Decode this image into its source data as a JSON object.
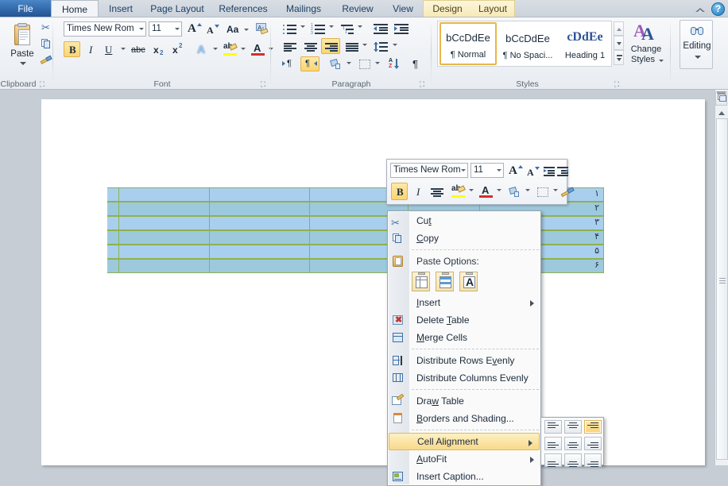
{
  "app": {
    "name": "Microsoft Word 2010"
  },
  "ribbon": {
    "tabs": [
      {
        "id": "file",
        "label": "File"
      },
      {
        "id": "home",
        "label": "Home"
      },
      {
        "id": "insert",
        "label": "Insert"
      },
      {
        "id": "page-layout",
        "label": "Page Layout"
      },
      {
        "id": "references",
        "label": "References"
      },
      {
        "id": "mailings",
        "label": "Mailings"
      },
      {
        "id": "review",
        "label": "Review"
      },
      {
        "id": "view",
        "label": "View"
      },
      {
        "id": "design",
        "label": "Design"
      },
      {
        "id": "layout",
        "label": "Layout"
      }
    ],
    "active_tab": "Home",
    "contextual_tabs": [
      "Design",
      "Layout"
    ],
    "help_icon": "help-question-icon",
    "collapse_icon": "collapse-ribbon-icon",
    "groups": {
      "clipboard": {
        "label": "Clipboard",
        "paste_label": "Paste",
        "paste_icon": "paste-clipboard-icon",
        "cut_icon": "cut-scissors-icon",
        "copy_icon": "copy-icon",
        "format_painter_icon": "format-painter-icon",
        "dialog_launcher": "dialog-launcher-icon"
      },
      "font": {
        "label": "Font",
        "font_name": "Times New Rom",
        "font_size": "11",
        "grow_font_icon": "grow-font-icon",
        "shrink_font_icon": "shrink-font-icon",
        "change_case_label": "Aa",
        "clear_formatting_icon": "clear-formatting-icon",
        "bold_label": "B",
        "italic_label": "I",
        "underline_label": "U",
        "strikethrough_label": "abc",
        "subscript_label": "x",
        "superscript_label": "x",
        "text_effects_label": "A",
        "highlight_label": "ab",
        "font_color_label": "A",
        "bold_active": true,
        "dialog_launcher": "dialog-launcher-icon"
      },
      "paragraph": {
        "label": "Paragraph",
        "bullets_icon": "bullets-icon",
        "numbering_icon": "numbering-icon",
        "multilevel_icon": "multilevel-list-icon",
        "decrease_indent_icon": "decrease-indent-icon",
        "increase_indent_icon": "increase-indent-icon",
        "align_left_icon": "align-left-icon",
        "align_center_icon": "align-center-icon",
        "align_right_icon": "align-right-icon",
        "justify_icon": "justify-icon",
        "line_spacing_icon": "line-spacing-icon",
        "ltr_icon": "left-to-right-icon",
        "rtl_icon": "right-to-left-icon",
        "shading_icon": "shading-icon",
        "borders_icon": "borders-icon",
        "sort_icon": "sort-icon",
        "show_marks_icon": "show-formatting-marks-icon",
        "align_right_active": true,
        "rtl_active": true,
        "dialog_launcher": "dialog-launcher-icon"
      },
      "styles": {
        "label": "Styles",
        "gallery": [
          {
            "preview": "bCcDdEe",
            "name": "¶ Normal",
            "selected": true
          },
          {
            "preview": "bCcDdEe",
            "name": "¶ No Spaci...",
            "selected": false
          },
          {
            "preview": "cDdEe",
            "name": "Heading 1",
            "selected": false
          }
        ],
        "scroll_up_icon": "scroll-up-icon",
        "scroll_down_icon": "scroll-down-icon",
        "more_icon": "more-styles-icon",
        "change_styles_label": "Change\nStyles",
        "change_styles_line1": "Change",
        "change_styles_line2": "Styles",
        "change_styles_icon": "change-styles-icon",
        "dialog_launcher": "dialog-launcher-icon"
      },
      "editing": {
        "label": "Editing",
        "editing_label": "Editing",
        "editing_icon": "find-binoculars-icon"
      }
    }
  },
  "document": {
    "table": {
      "rows": 6,
      "columns": 5,
      "row_numbers": [
        "۱",
        "۲",
        "۳",
        "۴",
        "۵",
        "۶"
      ],
      "selected": true,
      "selection_color_a": "#a9cfee",
      "selection_color_b": "#9dc9dd",
      "gridline_color": "#8fb14d"
    }
  },
  "mini_toolbar": {
    "font_name": "Times New Rom",
    "font_size": "11",
    "grow_font_icon": "grow-font-icon",
    "shrink_font_icon": "shrink-font-icon",
    "decrease_indent_icon": "decrease-indent-icon",
    "increase_indent_icon": "increase-indent-icon",
    "bold_label": "B",
    "italic_label": "I",
    "align_icon": "align-center-icon",
    "highlight_label": "ab",
    "font_color_label": "A",
    "shading_icon": "shading-icon",
    "borders_icon": "borders-icon",
    "format_painter_icon": "format-painter-icon",
    "bold_active": true
  },
  "context_menu": {
    "items": [
      {
        "label": "Cut",
        "icon": "cut-scissors-icon",
        "type": "item",
        "accel": 2
      },
      {
        "label": "Copy",
        "icon": "copy-icon",
        "type": "item",
        "accel": 0
      },
      {
        "label": "Paste Options:",
        "icon": "paste-clipboard-icon",
        "type": "header",
        "accel": -1
      },
      {
        "label": "Insert",
        "icon": "",
        "type": "submenu",
        "accel": 0
      },
      {
        "label": "Delete Table",
        "icon": "delete-table-icon",
        "type": "item",
        "accel": 7
      },
      {
        "label": "Merge Cells",
        "icon": "merge-cells-icon",
        "type": "item",
        "accel": 0
      },
      {
        "label": "Distribute Rows Evenly",
        "icon": "distribute-rows-icon",
        "type": "item",
        "accel": 17
      },
      {
        "label": "Distribute Columns Evenly",
        "icon": "distribute-cols-icon",
        "type": "item",
        "accel": 25
      },
      {
        "label": "Draw Table",
        "icon": "draw-table-icon",
        "type": "item",
        "accel": 3
      },
      {
        "label": "Borders and Shading...",
        "icon": "borders-shading-icon",
        "type": "item",
        "accel": 0
      },
      {
        "label": "Cell Alignment",
        "icon": "",
        "type": "submenu",
        "accel": -1,
        "highlighted": true
      },
      {
        "label": "AutoFit",
        "icon": "",
        "type": "submenu",
        "accel": 0
      },
      {
        "label": "Insert Caption...",
        "icon": "insert-caption-icon",
        "type": "item",
        "accel": -1
      }
    ],
    "paste_options": [
      {
        "name": "keep-source-formatting-icon",
        "glyph": "keep-source"
      },
      {
        "name": "merge-formatting-icon",
        "glyph": "merge"
      },
      {
        "name": "keep-text-only-icon",
        "glyph": "A"
      }
    ],
    "highlight_color": "#f8d98a"
  },
  "submenu": {
    "name": "cell-alignment-submenu",
    "options": [
      {
        "name": "align-top-left-icon",
        "selected": false
      },
      {
        "name": "align-top-center-icon",
        "selected": false
      },
      {
        "name": "align-top-right-icon",
        "selected": true
      },
      {
        "name": "align-center-left-icon",
        "selected": false
      },
      {
        "name": "align-center-icon",
        "selected": false
      },
      {
        "name": "align-center-right-icon",
        "selected": false
      },
      {
        "name": "align-bottom-left-icon",
        "selected": false
      },
      {
        "name": "align-bottom-center-icon",
        "selected": false
      },
      {
        "name": "align-bottom-right-icon",
        "selected": false
      }
    ]
  },
  "scrollbar": {
    "split_icon": "split-window-icon",
    "scroll_up_icon": "scroll-up-arrow-icon"
  }
}
